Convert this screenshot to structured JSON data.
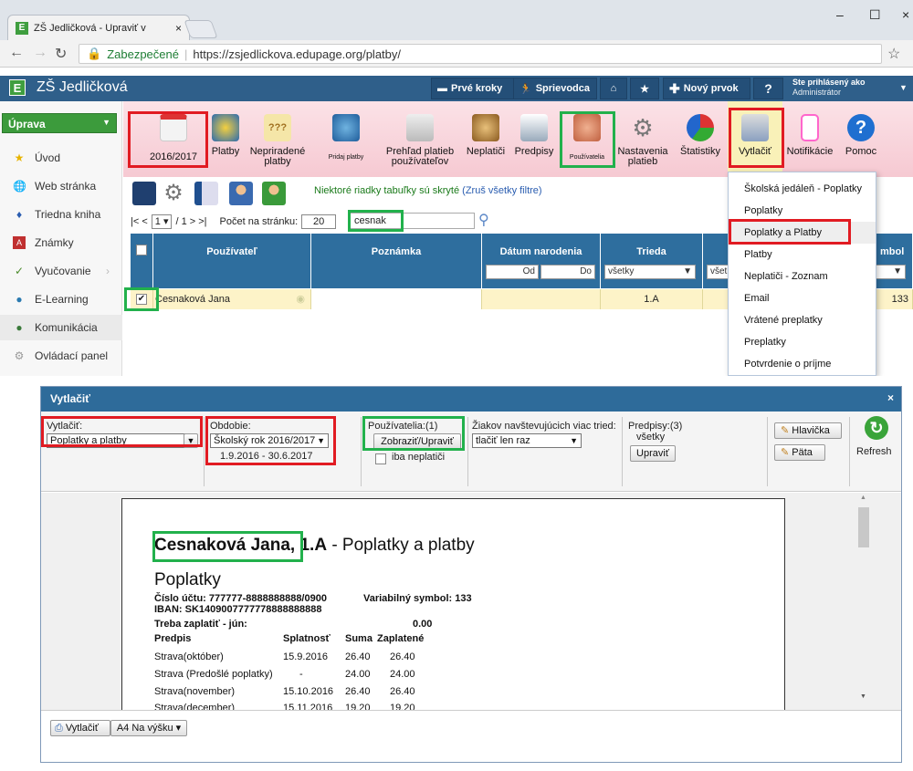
{
  "browser": {
    "tab_title": "ZŠ Jedličková - Upraviť v",
    "tab_close": "×",
    "tab_favicon": "E",
    "window_controls": {
      "minimize": "–",
      "maximize": "☐",
      "close": "×"
    },
    "secure_label": "Zabezpečené",
    "url": "https://zsjedlickova.edupage.org/platby/"
  },
  "appbar": {
    "logo": "E",
    "school_name": "ZŠ Jedličková",
    "buttons": [
      "Prvé kroky",
      "Sprievodca",
      "Nový prvok"
    ],
    "help": "?",
    "logged_label": "Ste prihlásený ako",
    "logged_role": "Administrátor"
  },
  "sidebar": {
    "header": "Úprava",
    "items": [
      "Úvod",
      "Web stránka",
      "Triedna kniha",
      "Známky",
      "Vyučovanie",
      "E-Learning",
      "Komunikácia",
      "Ovládací panel"
    ]
  },
  "ribbon": {
    "year": "2016/2017",
    "items": [
      {
        "label": "Platby"
      },
      {
        "label": "Nepriradené platby"
      },
      {
        "label": "Pridaj platby"
      },
      {
        "label": "Prehľad platieb používateľov"
      },
      {
        "label": "Neplatiči"
      },
      {
        "label": "Predpisy"
      },
      {
        "label": "Používatelia"
      },
      {
        "label": "Nastavenia platieb"
      },
      {
        "label": "Štatistiky"
      },
      {
        "label": "Vytlačiť"
      },
      {
        "label": "Notifikácie"
      },
      {
        "label": "Pomoc"
      }
    ]
  },
  "toolbar": {
    "hidden_msg": "Niektoré riadky tabuľky sú skryté",
    "hidden_link": "(Zruš všetky filtre)",
    "pager_first": "|< <",
    "pager_page": "1 ▾",
    "pager_of": "/ 1 > >|",
    "per_page_label": "Počet na stránku:",
    "per_page_value": "20",
    "search_value": "cesnak"
  },
  "table": {
    "columns": [
      "Používateľ",
      "Poznámka",
      "Dátum narodenia",
      "Trieda",
      "mbol"
    ],
    "filters": {
      "od": "Od",
      "do": "Do",
      "trieda": "všetky",
      "vset": "všet"
    },
    "row": {
      "user": "Cesnaková Jana",
      "trieda": "1.A",
      "symbol": "133"
    }
  },
  "dropdown": {
    "items": [
      "Školská jedáleň - Poplatky",
      "Poplatky",
      "Poplatky a Platby",
      "Platby",
      "Neplatiči - Zoznam",
      "Email",
      "Vrátené preplatky",
      "Preplatky",
      "Potvrdenie o príjme"
    ]
  },
  "dialog": {
    "title": "Vytlačiť",
    "close": "×",
    "print_label": "Vytlačiť:",
    "print_value": "Poplatky a platby",
    "period_label": "Obdobie:",
    "period_value": "Školský rok 2016/2017",
    "period_range": "1.9.2016 - 30.6.2017",
    "users_label": "Používatelia:(1)",
    "users_button": "Zobraziť/Upraviť",
    "only_debtors": "iba neplatiči",
    "multi_class_label": "Žiakov navštevujúcich viac tried:",
    "multi_class_value": "tlačiť len raz",
    "prescriptions_label": "Predpisy:(3)",
    "prescriptions_value": "všetky",
    "prescriptions_button": "Upraviť",
    "header_button": "Hlavička",
    "footer_button": "Päta",
    "refresh": "Refresh",
    "print_button": "Vytlačiť",
    "paper_button": "A4 Na výšku ▾"
  },
  "document": {
    "name": "Cesnaková Jana",
    "class": ", 1.A",
    "title_suffix": " - Poplatky a platby",
    "section": "Poplatky",
    "account": "Číslo účtu: 777777-8888888888/0900",
    "variable_symbol": "Variabilný symbol: 133",
    "iban": "IBAN: SK1409007777778888888888",
    "to_pay_label": "Treba zaplatiť - jún:",
    "to_pay_value": "0.00",
    "headers": [
      "Predpis",
      "Splatnosť",
      "Suma",
      "Zaplatené"
    ],
    "rows": [
      [
        "Strava(október)",
        "15.9.2016",
        "26.40",
        "26.40"
      ],
      [
        "Strava (Predošlé poplatky)",
        "-",
        "24.00",
        "24.00"
      ],
      [
        "Strava(november)",
        "15.10.2016",
        "26.40",
        "26.40"
      ],
      [
        "Strava(december)",
        "15.11.2016",
        "19.20",
        "19.20"
      ]
    ]
  },
  "colors": {
    "highlight_red": "#e11b22",
    "highlight_green": "#22b14c",
    "appbar": "#2f5f8a",
    "table_header": "#2e6e9e"
  }
}
